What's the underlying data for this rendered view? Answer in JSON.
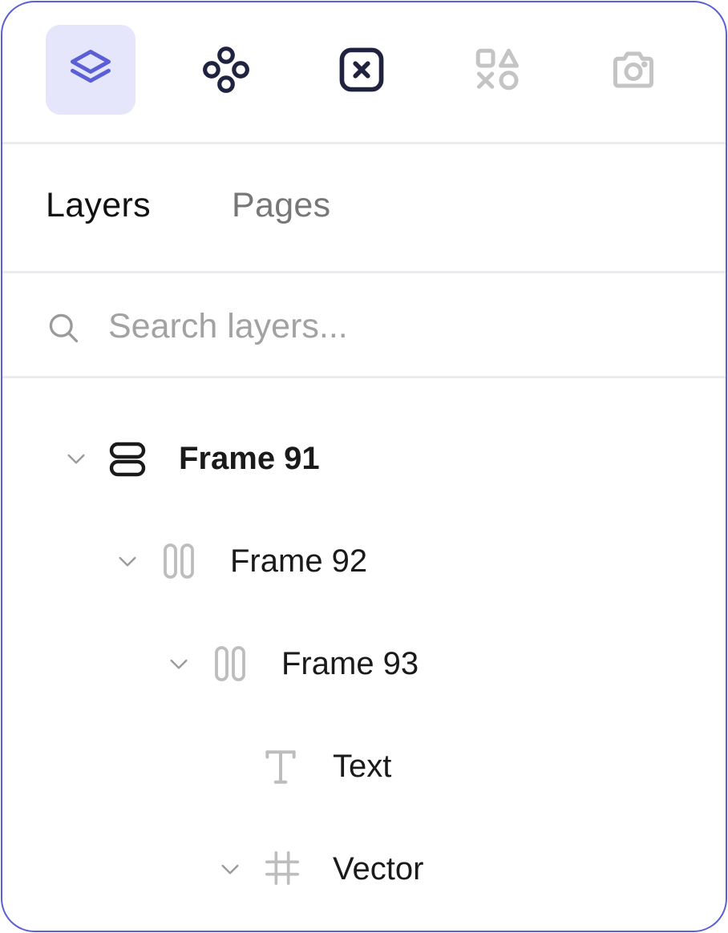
{
  "toolbar": {
    "tools": [
      {
        "icon": "layers-icon",
        "active": true
      },
      {
        "icon": "components-icon",
        "active": false
      },
      {
        "icon": "variables-icon",
        "active": false
      },
      {
        "icon": "assets-icon",
        "active": false
      },
      {
        "icon": "camera-icon",
        "active": false
      }
    ]
  },
  "tabs": {
    "layers": "Layers",
    "pages": "Pages",
    "active": "layers"
  },
  "search": {
    "placeholder": "Search layers...",
    "value": ""
  },
  "layers": [
    {
      "name": "Frame 91",
      "icon": "vertical-stack-icon",
      "expanded": true
    },
    {
      "name": "Frame 92",
      "icon": "columns-icon",
      "expanded": true
    },
    {
      "name": "Frame 93",
      "icon": "columns-icon",
      "expanded": true
    },
    {
      "name": "Text",
      "icon": "text-icon",
      "expanded": false
    },
    {
      "name": "Vector",
      "icon": "frame-grid-icon",
      "expanded": true
    }
  ],
  "colors": {
    "accent": "#5b5fd6",
    "active_bg": "#e5e6fb",
    "dark_icon": "#1f2340",
    "muted_icon": "#c4c4c4"
  }
}
